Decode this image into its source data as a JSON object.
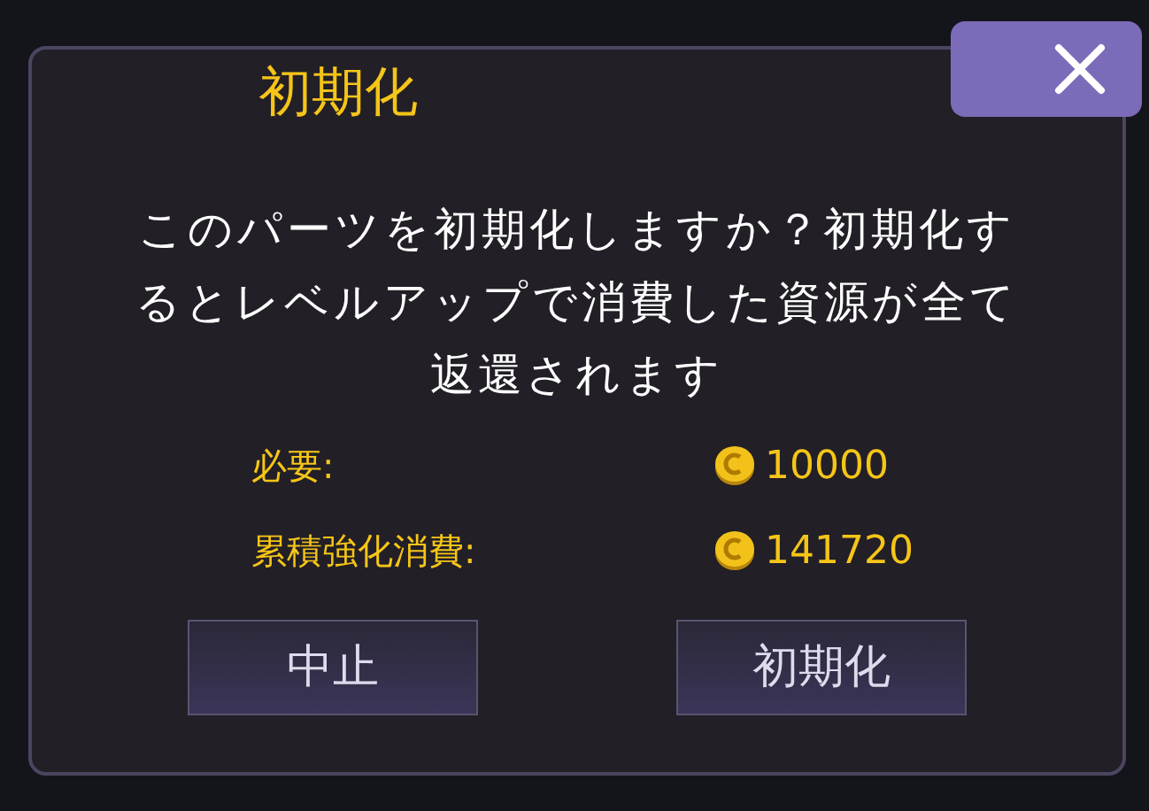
{
  "dialog": {
    "title": "初期化",
    "message": "このパーツを初期化しますか？初期化するとレベルアップで消費した資源が全て返還されます",
    "costs": [
      {
        "label": "必要:",
        "value": "10000"
      },
      {
        "label": "累積強化消費:",
        "value": "141720"
      }
    ],
    "buttons": [
      "中止",
      "初期化"
    ]
  }
}
